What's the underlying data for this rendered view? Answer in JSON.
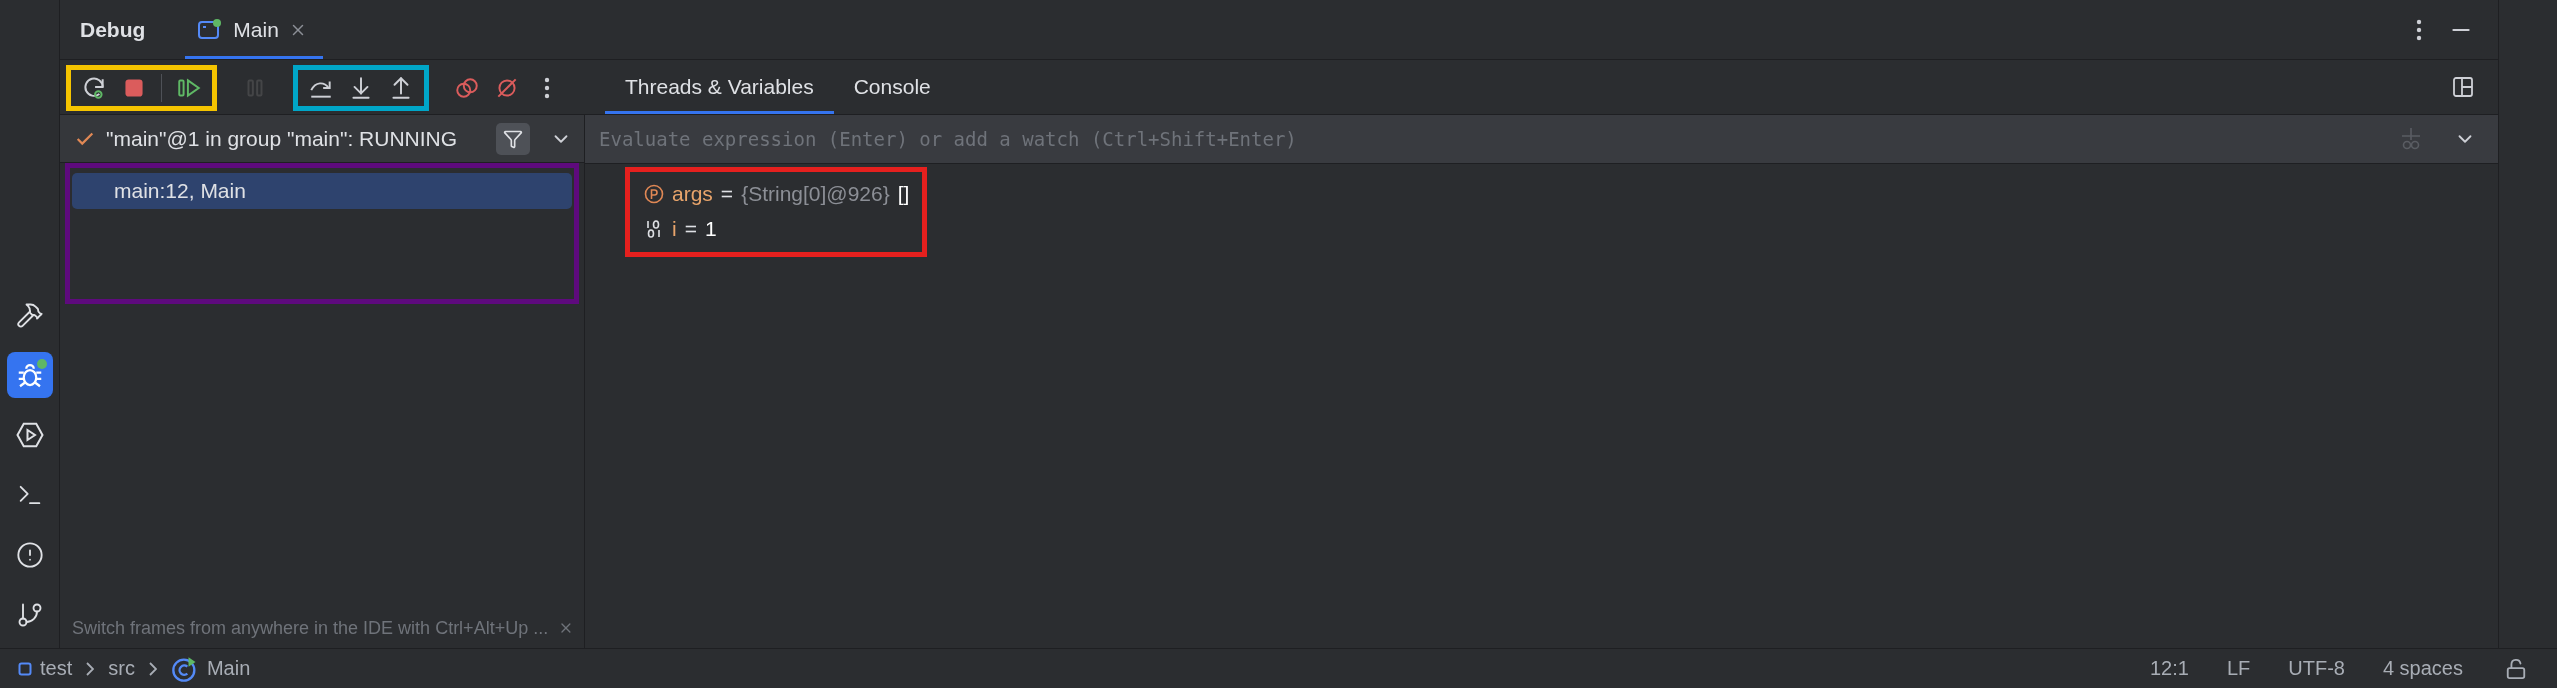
{
  "sidebar": {
    "items": [
      {
        "kind": "hammer",
        "selected": false
      },
      {
        "kind": "bug",
        "selected": true
      },
      {
        "kind": "run",
        "selected": false
      },
      {
        "kind": "terminal",
        "selected": false
      },
      {
        "kind": "problems",
        "selected": false
      },
      {
        "kind": "git",
        "selected": false
      }
    ]
  },
  "header": {
    "title": "Debug",
    "tabs": [
      {
        "label": "Main",
        "selected": true
      }
    ]
  },
  "toolbar": {
    "groups": [
      {
        "color": "#f5c400",
        "items": [
          {
            "kind": "rerun",
            "disabled": false
          },
          {
            "kind": "stop",
            "disabled": false
          },
          {
            "kind": "separator"
          },
          {
            "kind": "resume",
            "disabled": false
          }
        ]
      },
      {
        "items": [
          {
            "kind": "pause",
            "disabled": true
          }
        ]
      },
      {
        "color": "#00a6c8",
        "items": [
          {
            "kind": "step-over",
            "disabled": false
          },
          {
            "kind": "step-into",
            "disabled": false
          },
          {
            "kind": "step-out",
            "disabled": false
          }
        ]
      },
      {
        "items": [
          {
            "kind": "breakpoints",
            "disabled": false
          },
          {
            "kind": "mute",
            "disabled": false
          },
          {
            "kind": "more",
            "disabled": false
          }
        ]
      }
    ],
    "tabs": [
      {
        "label": "Threads & Variables",
        "selected": true
      },
      {
        "label": "Console",
        "selected": false
      }
    ]
  },
  "threads": {
    "status": "\"main\"@1 in group \"main\": RUNNING",
    "frames": {
      "color": "#5e0a7d",
      "items": [
        {
          "label": "main:12, Main",
          "selected": true
        }
      ]
    },
    "hint": "Switch frames from anywhere in the IDE with Ctrl+Alt+Up ..."
  },
  "evaluate": {
    "placeholder": "Evaluate expression (Enter) or add a watch (Ctrl+Shift+Enter)"
  },
  "variables": {
    "color": "#e5201e",
    "items": [
      {
        "kind": "parameter",
        "name": "args",
        "op": "=",
        "type": "{String[0]@926}",
        "value": "[]"
      },
      {
        "kind": "primitive",
        "name": "i",
        "op": "=",
        "value": "1"
      }
    ]
  },
  "status_bar": {
    "breadcrumbs": [
      {
        "kind": "module",
        "label": "test"
      },
      {
        "kind": "folder",
        "label": "src"
      },
      {
        "kind": "class",
        "label": "Main"
      }
    ],
    "items": [
      "12:1",
      "LF",
      "UTF-8",
      "4 spaces"
    ]
  }
}
